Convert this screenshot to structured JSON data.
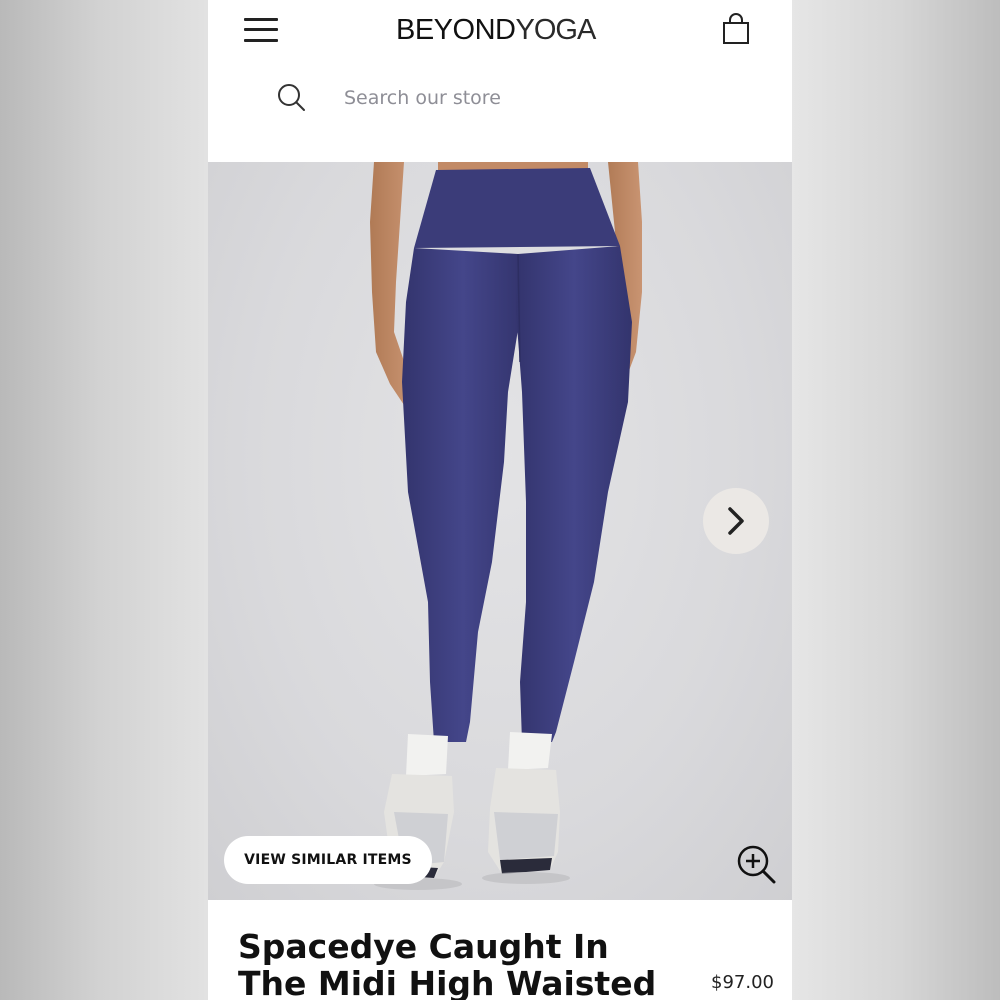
{
  "header": {
    "brand_bold": "BEYOND",
    "brand_light": "YOGA",
    "menu_icon": "hamburger-menu-icon",
    "cart_icon": "shopping-bag-icon"
  },
  "search": {
    "placeholder": "Search our store",
    "icon": "search-icon"
  },
  "gallery": {
    "next_icon": "chevron-right-icon",
    "zoom_icon": "zoom-in-icon",
    "similar_label": "VIEW SIMILAR ITEMS",
    "product_color": "#3e3f7e"
  },
  "product": {
    "title": "Spacedye Caught In The Midi High Waisted",
    "price": "$97.00"
  }
}
